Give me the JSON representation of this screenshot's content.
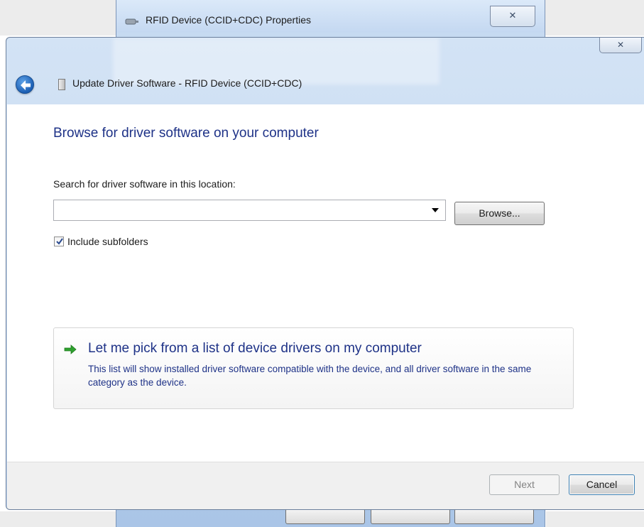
{
  "parent_window": {
    "title": "RFID Device (CCID+CDC) Properties",
    "close_glyph": "✕"
  },
  "dialog": {
    "title": "Update Driver Software - RFID Device (CCID+CDC)",
    "close_glyph": "✕"
  },
  "content": {
    "heading": "Browse for driver software on your computer",
    "location_label": "Search for driver software in this location:",
    "location_value": "",
    "browse_label": "Browse...",
    "include_subfolders_label": "Include subfolders",
    "include_subfolders_checked": true
  },
  "pick_option": {
    "title": "Let me pick from a list of device drivers on my computer",
    "description": "This list will show installed driver software compatible with the device, and all driver software in the same category as the device."
  },
  "footer": {
    "next_label": "Next",
    "next_enabled": false,
    "cancel_label": "Cancel"
  },
  "icons": {
    "back": "back-arrow-icon",
    "device": "device-icon",
    "parent_title": "rfid-device-icon",
    "pick": "green-arrow-icon",
    "checkbox": "checkmark-icon"
  },
  "colors": {
    "heading_blue": "#1e3287",
    "back_button_blue": "#1c5fb4",
    "arrow_green": "#2fa12f",
    "footer_bg": "#f0f0f0"
  }
}
